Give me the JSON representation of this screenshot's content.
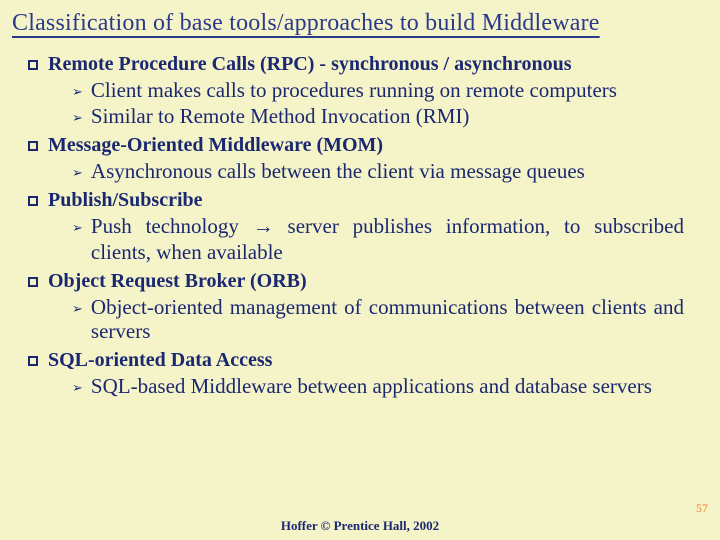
{
  "title": "Classification of base tools/approaches to build Middleware",
  "items": [
    {
      "label": "Remote Procedure Calls (RPC) -",
      "suffix": "synchronous / asynchronous",
      "sub": [
        "Client makes calls to procedures running on remote computers",
        "Similar to Remote Method Invocation (RMI)"
      ]
    },
    {
      "label": "Message-Oriented Middleware (MOM)",
      "suffix": "",
      "sub": [
        "Asynchronous calls between the client via message queues"
      ]
    },
    {
      "label": "Publish/Subscribe",
      "suffix": "",
      "sub": [
        "Push technology → server publishes information, to subscribed clients, when available"
      ]
    },
    {
      "label": "Object Request Broker (ORB)",
      "suffix": "",
      "sub": [
        "Object-oriented management of communications between clients and servers"
      ]
    },
    {
      "label": "SQL-oriented Data Access",
      "suffix": "",
      "sub": [
        "SQL-based Middleware between applications and database servers"
      ]
    }
  ],
  "footer": "Hoffer © Prentice Hall, 2002",
  "page_number": "57"
}
